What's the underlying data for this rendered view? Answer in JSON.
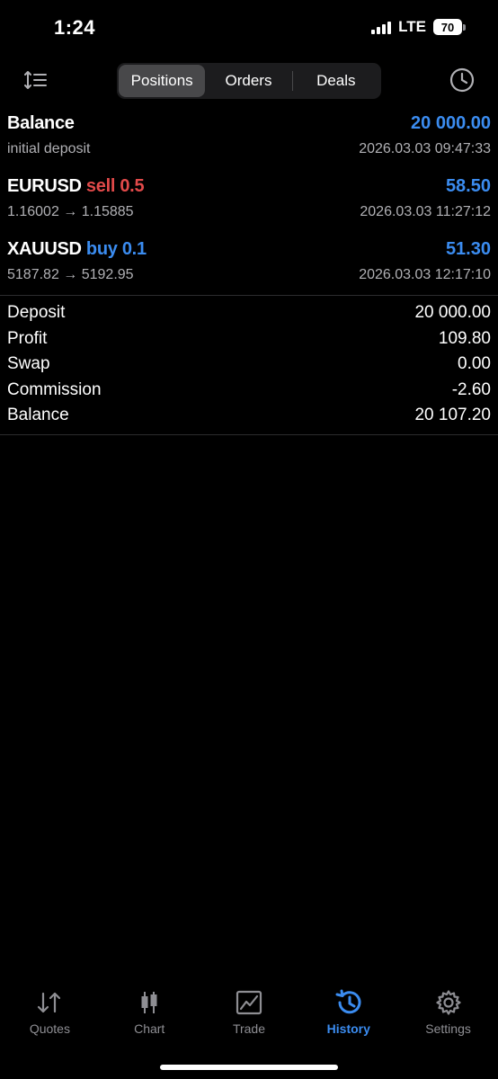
{
  "status_bar": {
    "time": "1:24",
    "network": "LTE",
    "battery": "70"
  },
  "toolbar": {
    "tabs": [
      {
        "label": "Positions",
        "active": true
      },
      {
        "label": "Orders",
        "active": false
      },
      {
        "label": "Deals",
        "active": false
      }
    ],
    "left_icon": "sort-icon",
    "right_icon": "clock-icon"
  },
  "rows": [
    {
      "symbol": "Balance",
      "direction": "",
      "volume": "",
      "subtitle": "initial deposit",
      "value": "20 000.00",
      "date": "2026.03.03 09:47:33"
    },
    {
      "symbol": "EURUSD",
      "direction": "sell",
      "volume": "0.5",
      "subtitle": "1.16002 → 1.15885",
      "value": "58.50",
      "date": "2026.03.03 11:27:12"
    },
    {
      "symbol": "XAUUSD",
      "direction": "buy",
      "volume": "0.1",
      "subtitle": "5187.82 → 5192.95",
      "value": "51.30",
      "date": "2026.03.03 12:17:10"
    }
  ],
  "summary": [
    {
      "label": "Deposit",
      "value": "20 000.00"
    },
    {
      "label": "Profit",
      "value": "109.80"
    },
    {
      "label": "Swap",
      "value": "0.00"
    },
    {
      "label": "Commission",
      "value": "-2.60"
    },
    {
      "label": "Balance",
      "value": "20 107.20"
    }
  ],
  "tabbar": [
    {
      "label": "Quotes",
      "icon": "quotes-icon",
      "active": false
    },
    {
      "label": "Chart",
      "icon": "candlestick-icon",
      "active": false
    },
    {
      "label": "Trade",
      "icon": "trade-chart-icon",
      "active": false
    },
    {
      "label": "History",
      "icon": "history-icon",
      "active": true
    },
    {
      "label": "Settings",
      "icon": "gear-icon",
      "active": false
    }
  ],
  "colors": {
    "accent": "#3b8cf0",
    "sell": "#e24a4a",
    "background": "#000000",
    "muted": "#8e8e93"
  }
}
